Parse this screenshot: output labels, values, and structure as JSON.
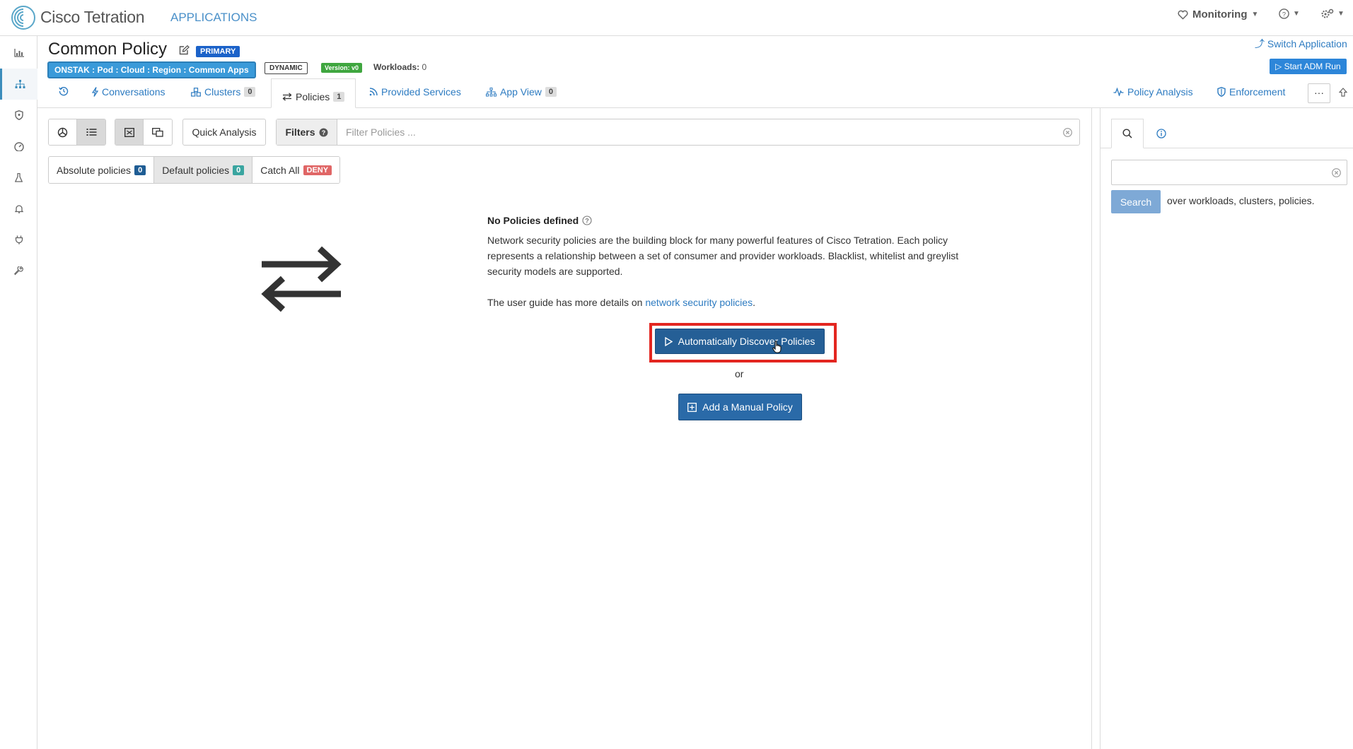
{
  "topbar": {
    "logo_text": "Cisco Tetration",
    "section": "APPLICATIONS",
    "monitoring_label": "Monitoring"
  },
  "header": {
    "title": "Common Policy",
    "primary_badge": "PRIMARY",
    "scope": "ONSTAK : Pod : Cloud : Region : Common Apps",
    "dynamic_badge": "DYNAMIC",
    "version_badge": "Version: v0",
    "workloads_label": "Workloads:",
    "workloads_value": "0",
    "switch_app": "Switch Application",
    "start_adm": "Start ADM Run"
  },
  "tabs": {
    "conversations": "Conversations",
    "clusters": "Clusters",
    "clusters_count": "0",
    "policies": "Policies",
    "policies_count": "1",
    "provided_services": "Provided Services",
    "app_view": "App View",
    "app_view_count": "0",
    "policy_analysis": "Policy Analysis",
    "enforcement": "Enforcement",
    "more": "···"
  },
  "toolbar": {
    "quick_analysis": "Quick Analysis",
    "filters_label": "Filters",
    "filter_placeholder": "Filter Policies ..."
  },
  "policy_types": {
    "absolute": "Absolute policies",
    "absolute_count": "0",
    "default": "Default policies",
    "default_count": "0",
    "catch_all": "Catch All",
    "catch_all_badge": "DENY"
  },
  "empty_state": {
    "title": "No Policies defined",
    "description": "Network security policies are the building block for many powerful features of Cisco Tetration. Each policy represents a relationship between a set of consumer and provider workloads. Blacklist, whitelist and greylist security models are supported.",
    "guide_prefix": "The user guide has more details on ",
    "guide_link": "network security policies",
    "guide_suffix": ".",
    "discover_button": "Automatically Discover Policies",
    "or": "or",
    "manual_button": "Add a Manual Policy"
  },
  "right_panel": {
    "search_button": "Search",
    "hint": "over workloads, clusters, policies."
  },
  "colors": {
    "accent": "#2d7bc1",
    "primary_button": "#255f96",
    "highlight": "#e32620",
    "deny": "#e06666"
  }
}
